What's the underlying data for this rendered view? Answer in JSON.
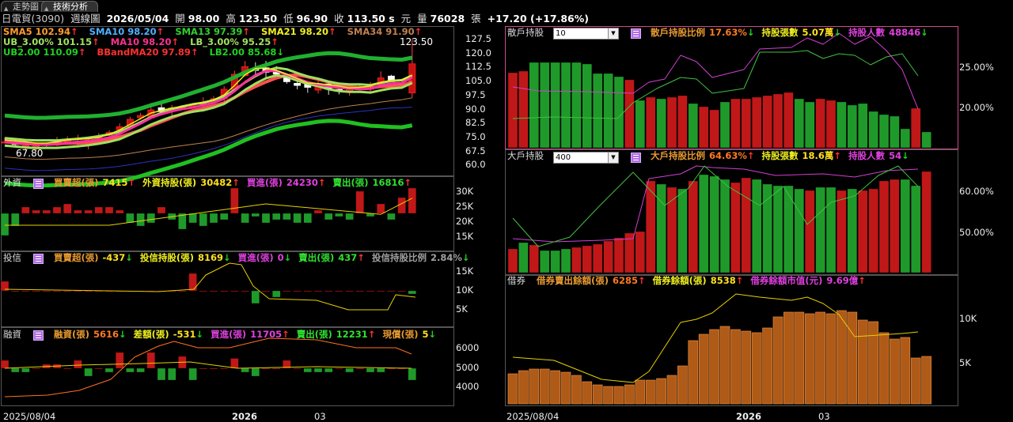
{
  "tabs": [
    {
      "label": "走勢圖"
    },
    {
      "label": "技術分析"
    }
  ],
  "info": {
    "stock": "日電貿(3090)",
    "period": "週線圖",
    "date": "2026/05/04",
    "open_label": "開",
    "open": "98.00",
    "high_label": "高",
    "high": "123.50",
    "low_label": "低",
    "low": "96.90",
    "close_label": "收",
    "close": "113.50 s",
    "unit": "元",
    "vol_label": "量",
    "volume": "76028",
    "vol_unit": "張",
    "change": "+17.20 (+17.86%)"
  },
  "colors": {
    "up": "#c01818",
    "down": "#1f9a2a",
    "price_up": "#ff3030",
    "price_down": "#20c020",
    "magenta": "#e040e0",
    "yellow": "#e8d000",
    "orange": "#ff7a20"
  },
  "main": {
    "legend1": [
      {
        "text": "SMA5 102.94",
        "color": "#ff9b30",
        "arrow": "↑",
        "acolor": "#ff3030"
      },
      {
        "text": "SMA10 98.20",
        "color": "#50b0ff",
        "arrow": "↑",
        "acolor": "#ff3030"
      },
      {
        "text": "SMA13 97.39",
        "color": "#30d030",
        "arrow": "↑",
        "acolor": "#ff3030"
      },
      {
        "text": "SMA21 98.20",
        "color": "#f0f020",
        "arrow": "↑",
        "acolor": "#ff3030"
      },
      {
        "text": "SMA34 91.90",
        "color": "#c08050",
        "arrow": "↑",
        "acolor": "#ff3030"
      }
    ],
    "legend2": [
      {
        "text": "UB_3.00% 101.15",
        "color": "#a0e060",
        "arrow": "↑",
        "acolor": "#ff3030"
      },
      {
        "text": "MA10 98.20",
        "color": "#ff3090",
        "arrow": "↑",
        "acolor": "#ff3030"
      },
      {
        "text": "LB_3.00% 95.25",
        "color": "#a0e060",
        "arrow": "↑",
        "acolor": "#ff3030"
      }
    ],
    "legend3": [
      {
        "text": "UB2.00 110.09",
        "color": "#20d020",
        "arrow": "↑",
        "acolor": "#ff3030"
      },
      {
        "text": "BBandMA20 97.89",
        "color": "#ff3030",
        "arrow": "↑",
        "acolor": "#ff3030"
      },
      {
        "text": "LB2.00 85.68",
        "color": "#20d020",
        "arrow": "↓",
        "acolor": "#20d020"
      }
    ],
    "max_label": "123.50",
    "min_label": "67.80",
    "yticks": [
      "127.5",
      "120.0",
      "112.5",
      "105.0",
      "97.5",
      "90.0",
      "82.5",
      "75.0",
      "67.5",
      "60.0"
    ]
  },
  "foreign": {
    "title": "外資",
    "items": [
      {
        "text": "買賣超(張)",
        "color": "#e89a30"
      },
      {
        "text": "7415",
        "color": "#ffe020",
        "arrow": "↑",
        "acolor": "#ff3030"
      },
      {
        "text": "外資持股(張)",
        "color": "#f0f020"
      },
      {
        "text": "30482",
        "color": "#ffe020",
        "arrow": "↑",
        "acolor": "#ff3030"
      },
      {
        "text": "買進(張)",
        "color": "#e040e0"
      },
      {
        "text": "24230",
        "color": "#e040e0",
        "arrow": "↑",
        "acolor": "#ff3030"
      },
      {
        "text": "賣出(張)",
        "color": "#30e030"
      },
      {
        "text": "16816",
        "color": "#30e030",
        "arrow": "↑",
        "acolor": "#ff3030"
      }
    ],
    "yticks": [
      "30K",
      "25K",
      "20K",
      "15K"
    ]
  },
  "trust": {
    "title": "投信",
    "items": [
      {
        "text": "買賣超(張)",
        "color": "#e89a30"
      },
      {
        "text": "-437",
        "color": "#ffe020",
        "arrow": "↓",
        "acolor": "#20d020"
      },
      {
        "text": "投信持股(張)",
        "color": "#f0f020"
      },
      {
        "text": "8169",
        "color": "#ffe020",
        "arrow": "↓",
        "acolor": "#20d020"
      },
      {
        "text": "買進(張)",
        "color": "#e040e0"
      },
      {
        "text": "0",
        "color": "#e040e0",
        "arrow": "↓",
        "acolor": "#20d020"
      },
      {
        "text": "賣出(張)",
        "color": "#30e030"
      },
      {
        "text": "437",
        "color": "#30e030",
        "arrow": "↑",
        "acolor": "#ff3030"
      },
      {
        "text": "投信持股比例",
        "color": "#a0a0a0"
      },
      {
        "text": "2.84%",
        "color": "#a0a0a0",
        "arrow": "↓",
        "acolor": "#20d020"
      }
    ],
    "yticks": [
      "15K",
      "10K",
      "5K"
    ]
  },
  "margin": {
    "title": "融資",
    "items": [
      {
        "text": "融資(張)",
        "color": "#e89a30"
      },
      {
        "text": "5616",
        "color": "#ff7a20",
        "arrow": "↓",
        "acolor": "#20d020"
      },
      {
        "text": "差額(張)",
        "color": "#f0f020"
      },
      {
        "text": "-531",
        "color": "#ffe020",
        "arrow": "↓",
        "acolor": "#20d020"
      },
      {
        "text": "買進(張)",
        "color": "#e040e0"
      },
      {
        "text": "11705",
        "color": "#e040e0",
        "arrow": "↑",
        "acolor": "#ff3030"
      },
      {
        "text": "賣出(張)",
        "color": "#30e030"
      },
      {
        "text": "12231",
        "color": "#30e030",
        "arrow": "↑",
        "acolor": "#ff3030"
      },
      {
        "text": "現償(張)",
        "color": "#e89a30"
      },
      {
        "text": "5",
        "color": "#ffe020",
        "arrow": "↓",
        "acolor": "#20d020"
      }
    ],
    "yticks": [
      "6000",
      "5000",
      "4000"
    ]
  },
  "retail": {
    "title": "散戶持股",
    "select": "10",
    "items": [
      {
        "text": "散戶持股比例",
        "color": "#e89a30"
      },
      {
        "text": "17.63%",
        "color": "#ff7a20",
        "arrow": "↓",
        "acolor": "#20d020"
      },
      {
        "text": "持股張數",
        "color": "#f0f020"
      },
      {
        "text": "5.07萬",
        "color": "#ffe020",
        "arrow": "↓",
        "acolor": "#20d020"
      },
      {
        "text": "持股人數",
        "color": "#e040e0"
      },
      {
        "text": "48846",
        "color": "#e040e0",
        "arrow": "↓",
        "acolor": "#20d020"
      }
    ],
    "yticks": [
      "25.00%",
      "20.00%"
    ]
  },
  "major": {
    "title": "大戶持股",
    "select": "400",
    "items": [
      {
        "text": "大戶持股比例",
        "color": "#e89a30"
      },
      {
        "text": "64.63%",
        "color": "#ff7a20",
        "arrow": "↑",
        "acolor": "#ff3030"
      },
      {
        "text": "持股張數",
        "color": "#f0f020"
      },
      {
        "text": "18.6萬",
        "color": "#ffe020",
        "arrow": "↑",
        "acolor": "#ff3030"
      },
      {
        "text": "持股人數",
        "color": "#e040e0"
      },
      {
        "text": "54",
        "color": "#e040e0",
        "arrow": "↓",
        "acolor": "#20d020"
      }
    ],
    "yticks": [
      "60.00%",
      "50.00%"
    ]
  },
  "short": {
    "title": "借券",
    "items": [
      {
        "text": "借券賣出餘額(張)",
        "color": "#e89a30"
      },
      {
        "text": "6285",
        "color": "#ff7a20",
        "arrow": "↑",
        "acolor": "#ff3030"
      },
      {
        "text": "借券餘額(張)",
        "color": "#f0f020"
      },
      {
        "text": "8538",
        "color": "#ffe020",
        "arrow": "↑",
        "acolor": "#ff3030"
      },
      {
        "text": "借券餘額市值(元)",
        "color": "#e040e0"
      },
      {
        "text": "9.69億",
        "color": "#e040e0",
        "arrow": "↑",
        "acolor": "#ff3030"
      }
    ],
    "yticks": [
      "10K",
      "5K"
    ]
  },
  "xaxis": {
    "left": [
      "2025/08/04",
      "2026",
      "03"
    ],
    "right": [
      "2025/08/04",
      "2026",
      "03"
    ]
  }
}
